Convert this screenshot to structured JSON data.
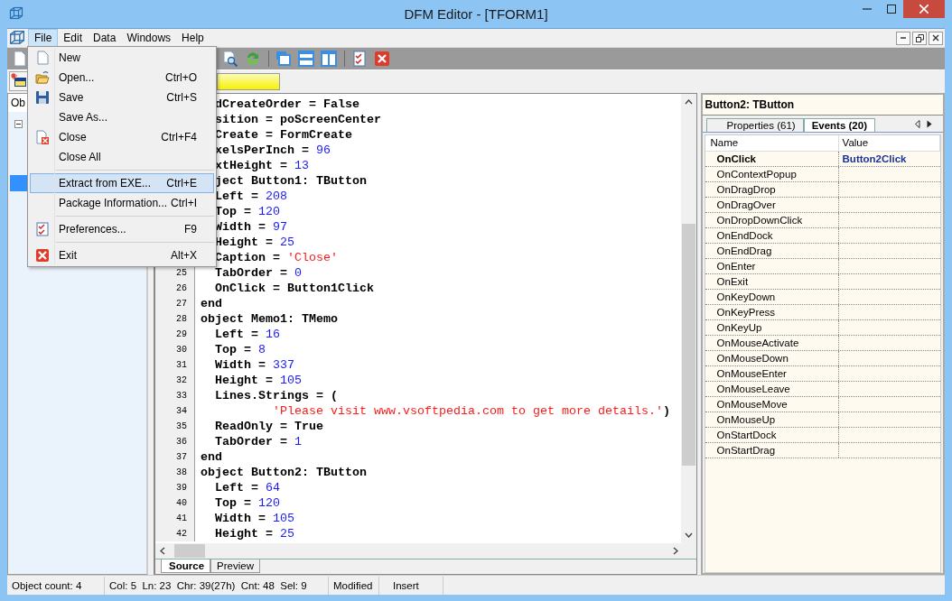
{
  "window": {
    "title": "DFM Editor - [TFORM1]"
  },
  "menu_bar": [
    {
      "label": "File",
      "selected": true
    },
    {
      "label": "Edit",
      "selected": false
    },
    {
      "label": "Data",
      "selected": false
    },
    {
      "label": "Windows",
      "selected": false
    },
    {
      "label": "Help",
      "selected": false
    }
  ],
  "file_menu": [
    {
      "kind": "item",
      "label": "New",
      "highlighted": false
    },
    {
      "kind": "item",
      "label": "Open...",
      "shortcut": "Ctrl+O",
      "highlighted": false
    },
    {
      "kind": "item",
      "label": "Save",
      "shortcut": "Ctrl+S",
      "highlighted": false
    },
    {
      "kind": "item",
      "label": "Save As...",
      "highlighted": false
    },
    {
      "kind": "item",
      "label": "Close",
      "shortcut": "Ctrl+F4",
      "highlighted": false
    },
    {
      "kind": "item",
      "label": "Close All",
      "highlighted": false
    },
    {
      "kind": "separator"
    },
    {
      "kind": "item",
      "label": "Extract from EXE...",
      "shortcut": "Ctrl+E",
      "highlighted": true
    },
    {
      "kind": "item",
      "label": "Package Information...",
      "shortcut": "Ctrl+I",
      "highlighted": false
    },
    {
      "kind": "separator"
    },
    {
      "kind": "item",
      "label": "Preferences...",
      "shortcut": "F9",
      "highlighted": false
    },
    {
      "kind": "separator"
    },
    {
      "kind": "item",
      "label": "Exit",
      "shortcut": "Alt+X",
      "highlighted": false
    }
  ],
  "tree": {
    "header": "Ob",
    "rows": [
      {
        "expanded": true,
        "selected": false
      },
      {
        "selected": false
      },
      {
        "selected": false
      },
      {
        "selected": true
      }
    ]
  },
  "editor": {
    "lines": [
      {
        "partial": true,
        "parts": [
          {
            "kind": "plain",
            "text": "dCreateOrder = False"
          }
        ]
      },
      {
        "partial": true,
        "parts": [
          {
            "kind": "plain",
            "text": "sition = poScreenCenter"
          }
        ]
      },
      {
        "partial": true,
        "parts": [
          {
            "kind": "plain",
            "text": "Create = FormCreate"
          }
        ]
      },
      {
        "partial": true,
        "parts": [
          {
            "kind": "plain",
            "text": "xelsPerInch = "
          },
          {
            "kind": "number",
            "text": "96"
          }
        ]
      },
      {
        "partial": true,
        "parts": [
          {
            "kind": "plain",
            "text": "xtHeight = "
          },
          {
            "kind": "number",
            "text": "13"
          }
        ]
      },
      {
        "partial": true,
        "parts": [
          {
            "kind": "plain",
            "text": "ject Button1: TButton"
          }
        ]
      },
      {
        "partial": true,
        "parts": [
          {
            "kind": "plain",
            "text": "Left = "
          },
          {
            "kind": "number",
            "text": "208"
          }
        ]
      },
      {
        "partial": true,
        "parts": [
          {
            "kind": "plain",
            "text": "Top = "
          },
          {
            "kind": "number",
            "text": "120"
          }
        ]
      },
      {
        "partial": true,
        "parts": [
          {
            "kind": "plain",
            "text": "Width = "
          },
          {
            "kind": "number",
            "text": "97"
          }
        ]
      },
      {
        "partial": true,
        "parts": [
          {
            "kind": "plain",
            "text": "Height = "
          },
          {
            "kind": "number",
            "text": "25"
          }
        ]
      },
      {
        "partial": true,
        "parts": [
          {
            "kind": "plain",
            "text": "Caption = "
          },
          {
            "kind": "string",
            "text": "'Close'"
          }
        ]
      },
      {
        "number": "25",
        "parts": [
          {
            "kind": "plain",
            "text": "  TabOrder = "
          },
          {
            "kind": "number",
            "text": "0"
          }
        ]
      },
      {
        "number": "26",
        "parts": [
          {
            "kind": "plain",
            "text": "  OnClick = Button1Click"
          }
        ]
      },
      {
        "number": "27",
        "parts": [
          {
            "kind": "plain",
            "text": "end"
          }
        ]
      },
      {
        "number": "28",
        "parts": [
          {
            "kind": "plain",
            "text": "object Memo1: TMemo"
          }
        ]
      },
      {
        "number": "29",
        "parts": [
          {
            "kind": "plain",
            "text": "  Left = "
          },
          {
            "kind": "number",
            "text": "16"
          }
        ]
      },
      {
        "number": "30",
        "parts": [
          {
            "kind": "plain",
            "text": "  Top = "
          },
          {
            "kind": "number",
            "text": "8"
          }
        ]
      },
      {
        "number": "31",
        "parts": [
          {
            "kind": "plain",
            "text": "  Width = "
          },
          {
            "kind": "number",
            "text": "337"
          }
        ]
      },
      {
        "number": "32",
        "parts": [
          {
            "kind": "plain",
            "text": "  Height = "
          },
          {
            "kind": "number",
            "text": "105"
          }
        ]
      },
      {
        "number": "33",
        "parts": [
          {
            "kind": "plain",
            "text": "  Lines.Strings = ("
          }
        ]
      },
      {
        "number": "34",
        "parts": [
          {
            "kind": "string",
            "text": "          'Please visit www.vsoftpedia.com to get more details.'"
          },
          {
            "kind": "plain",
            "text": ")"
          }
        ]
      },
      {
        "number": "35",
        "parts": [
          {
            "kind": "plain",
            "text": "  ReadOnly = True"
          }
        ]
      },
      {
        "number": "36",
        "parts": [
          {
            "kind": "plain",
            "text": "  TabOrder = "
          },
          {
            "kind": "number",
            "text": "1"
          }
        ]
      },
      {
        "number": "37",
        "parts": [
          {
            "kind": "plain",
            "text": "end"
          }
        ]
      },
      {
        "number": "38",
        "parts": [
          {
            "kind": "plain",
            "text": "object Button2: TButton"
          }
        ]
      },
      {
        "number": "39",
        "parts": [
          {
            "kind": "plain",
            "text": "  Left = "
          },
          {
            "kind": "number",
            "text": "64"
          }
        ]
      },
      {
        "number": "40",
        "parts": [
          {
            "kind": "plain",
            "text": "  Top = "
          },
          {
            "kind": "number",
            "text": "120"
          }
        ]
      },
      {
        "number": "41",
        "parts": [
          {
            "kind": "plain",
            "text": "  Width = "
          },
          {
            "kind": "number",
            "text": "105"
          }
        ]
      },
      {
        "number": "42",
        "parts": [
          {
            "kind": "plain",
            "text": "  Height = "
          },
          {
            "kind": "number",
            "text": "25"
          }
        ]
      }
    ],
    "tabs": [
      {
        "label": "Source",
        "selected": true
      },
      {
        "label": "Preview",
        "selected": false
      }
    ]
  },
  "inspector": {
    "title": "Button2: TButton",
    "tabs": [
      {
        "label": "Properties (61)",
        "selected": false
      },
      {
        "label": "Events (20)",
        "selected": true
      }
    ],
    "columns": [
      "Name",
      "Value"
    ],
    "rows": [
      {
        "name": "OnClick",
        "value": "Button2Click"
      },
      {
        "name": "OnContextPopup"
      },
      {
        "name": "OnDragDrop"
      },
      {
        "name": "OnDragOver"
      },
      {
        "name": "OnDropDownClick"
      },
      {
        "name": "OnEndDock"
      },
      {
        "name": "OnEndDrag"
      },
      {
        "name": "OnEnter"
      },
      {
        "name": "OnExit"
      },
      {
        "name": "OnKeyDown"
      },
      {
        "name": "OnKeyPress"
      },
      {
        "name": "OnKeyUp"
      },
      {
        "name": "OnMouseActivate"
      },
      {
        "name": "OnMouseDown"
      },
      {
        "name": "OnMouseEnter"
      },
      {
        "name": "OnMouseLeave"
      },
      {
        "name": "OnMouseMove"
      },
      {
        "name": "OnMouseUp"
      },
      {
        "name": "OnStartDock"
      },
      {
        "name": "OnStartDrag"
      }
    ]
  },
  "status_bar": [
    "Object count: 4",
    "Col: 5  Ln: 23  Chr: 39(27h)  Cnt: 48  Sel: 9",
    "Modified",
    "Insert"
  ]
}
